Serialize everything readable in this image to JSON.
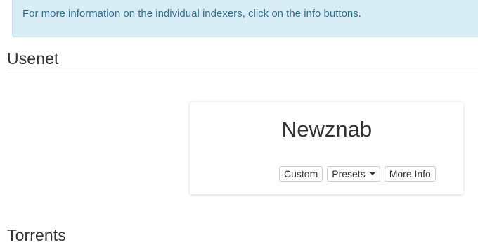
{
  "info_alert": {
    "text": "For more information on the individual indexers, click on the info buttons."
  },
  "sections": {
    "usenet": {
      "heading": "Usenet"
    },
    "torrents": {
      "heading": "Torrents"
    }
  },
  "indexer_card": {
    "title": "Newznab",
    "buttons": {
      "custom": "Custom",
      "presets": "Presets",
      "more_info": "More Info"
    },
    "presets_icon": "caret-down-icon"
  }
}
